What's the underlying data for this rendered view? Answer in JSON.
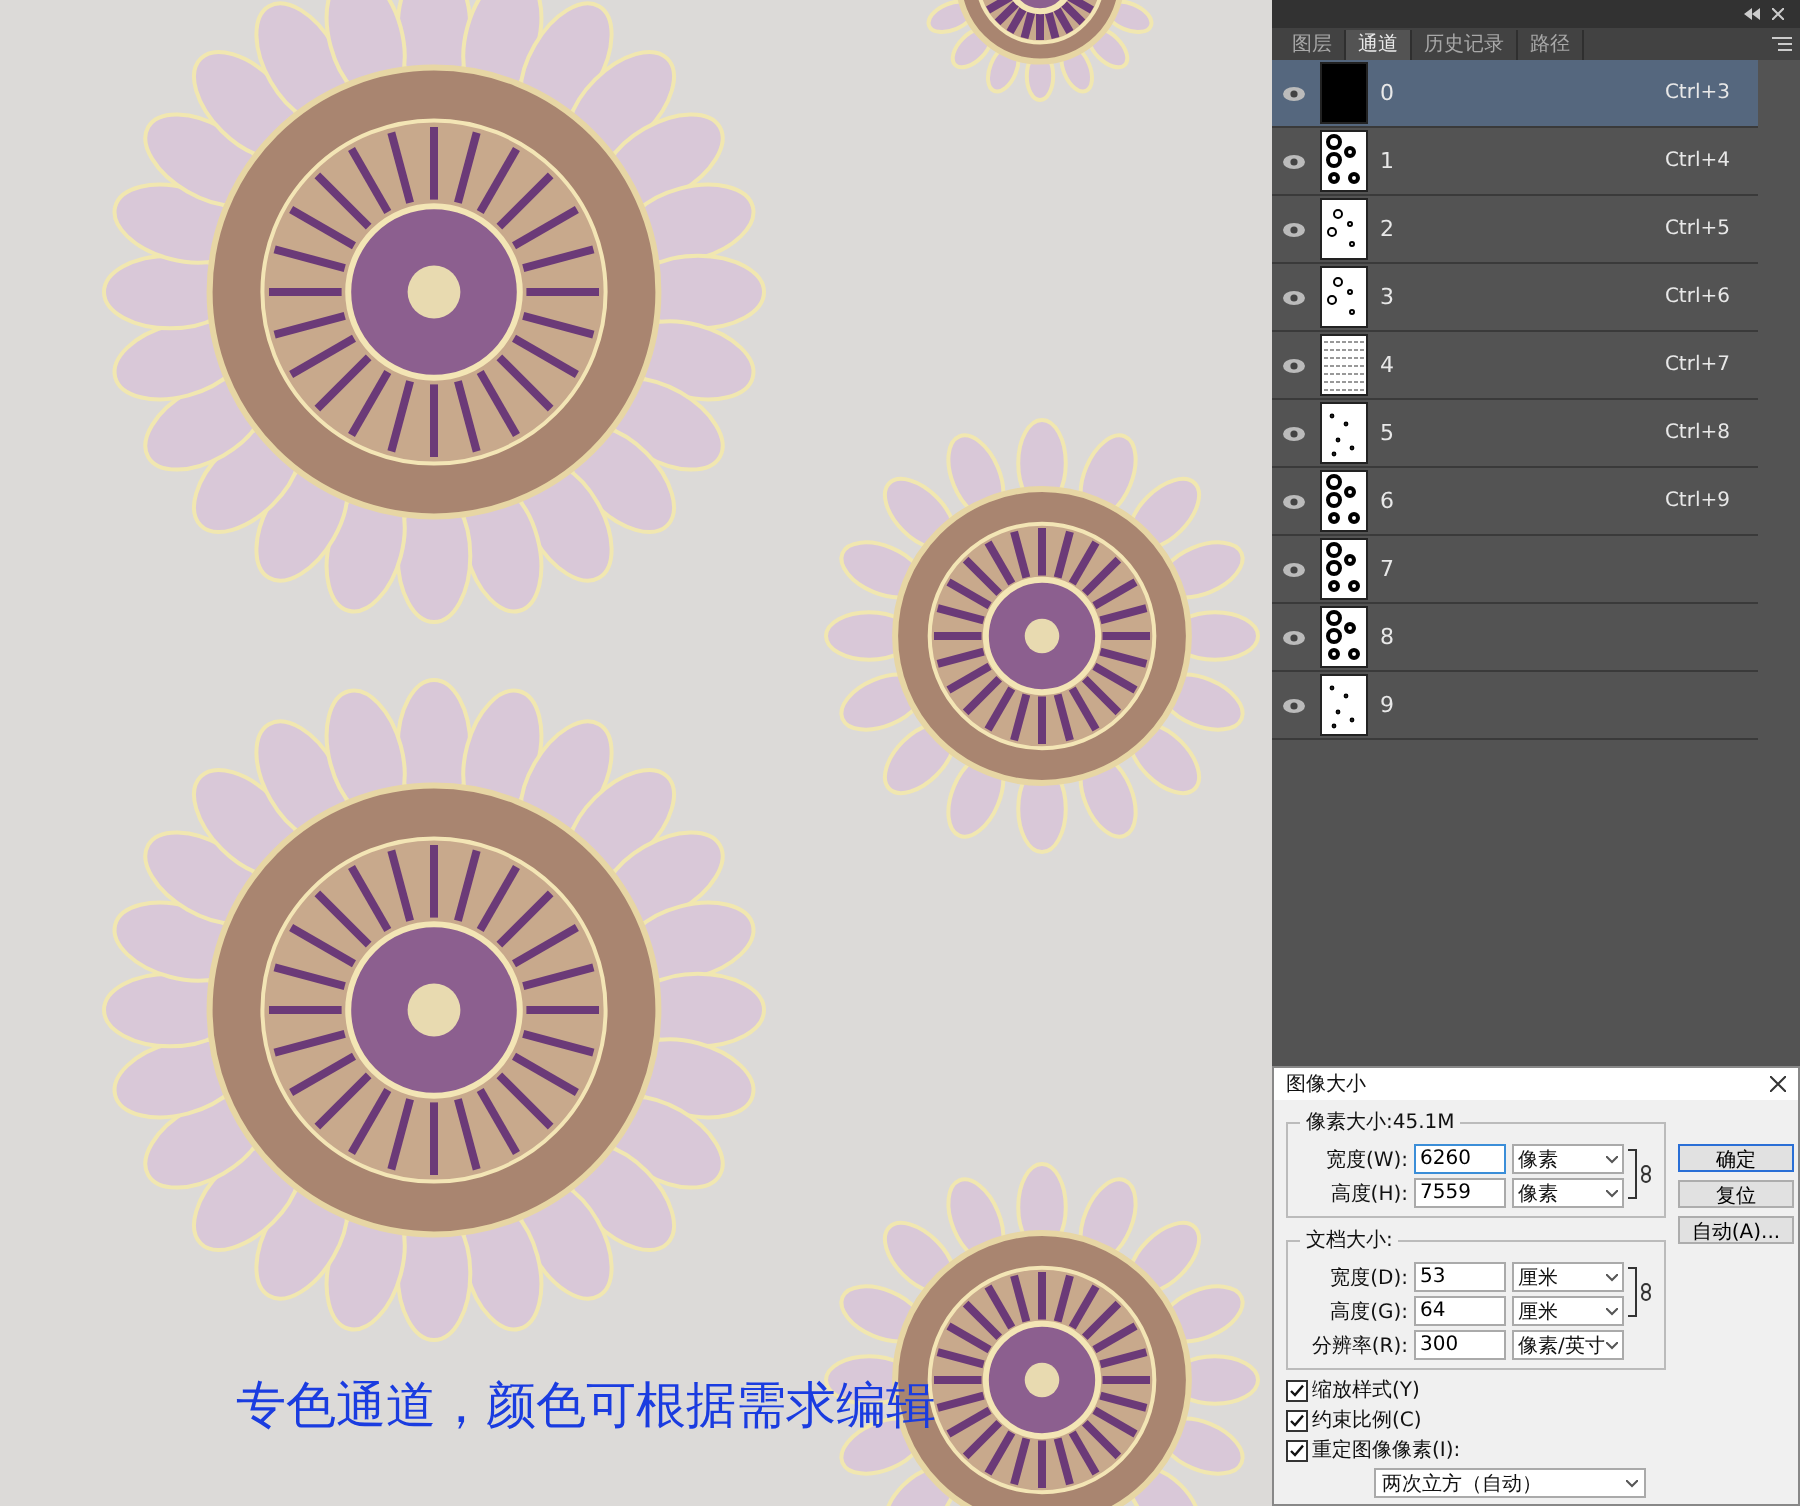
{
  "caption": "专色通道，颜色可根据需求编辑",
  "panel": {
    "tabs": [
      {
        "label": "图层",
        "selected": false
      },
      {
        "label": "通道",
        "selected": true
      },
      {
        "label": "历史记录",
        "selected": false
      },
      {
        "label": "路径",
        "selected": false
      }
    ],
    "channels": [
      {
        "name": "0",
        "shortcut": "Ctrl+3",
        "visible": true,
        "selected": true,
        "kind": "solid"
      },
      {
        "name": "1",
        "shortcut": "Ctrl+4",
        "visible": true,
        "selected": false,
        "kind": "dense"
      },
      {
        "name": "2",
        "shortcut": "Ctrl+5",
        "visible": true,
        "selected": false,
        "kind": "sparse"
      },
      {
        "name": "3",
        "shortcut": "Ctrl+6",
        "visible": true,
        "selected": false,
        "kind": "sparse"
      },
      {
        "name": "4",
        "shortcut": "Ctrl+7",
        "visible": true,
        "selected": false,
        "kind": "texture"
      },
      {
        "name": "5",
        "shortcut": "Ctrl+8",
        "visible": true,
        "selected": false,
        "kind": "specks"
      },
      {
        "name": "6",
        "shortcut": "Ctrl+9",
        "visible": true,
        "selected": false,
        "kind": "dense"
      },
      {
        "name": "7",
        "visible": true,
        "selected": false,
        "kind": "dense"
      },
      {
        "name": "8",
        "visible": true,
        "selected": false,
        "kind": "dense"
      },
      {
        "name": "9",
        "visible": true,
        "selected": false,
        "kind": "specks"
      }
    ]
  },
  "dialog": {
    "title": "图像大小",
    "pixel_group": {
      "legend": "像素大小:45.1M",
      "fields": [
        {
          "label": "宽度(W):",
          "value": "6260",
          "unit": "像素"
        },
        {
          "label": "高度(H):",
          "value": "7559",
          "unit": "像素"
        }
      ]
    },
    "doc_group": {
      "legend": "文档大小:",
      "fields": [
        {
          "label": "宽度(D):",
          "value": "53",
          "unit": "厘米"
        },
        {
          "label": "高度(G):",
          "value": "64",
          "unit": "厘米"
        },
        {
          "label": "分辨率(R):",
          "value": "300",
          "unit": "像素/英寸"
        }
      ]
    },
    "buttons": [
      {
        "label": "确定",
        "default": true
      },
      {
        "label": "复位",
        "default": false
      },
      {
        "label": "自动(A)...",
        "default": false
      }
    ],
    "checkboxes": [
      {
        "label": "缩放样式(Y)",
        "checked": true
      },
      {
        "label": "约束比例(C)",
        "checked": true
      },
      {
        "label": "重定图像像素(I):",
        "checked": true
      }
    ],
    "resample": "两次立方（自动）"
  }
}
